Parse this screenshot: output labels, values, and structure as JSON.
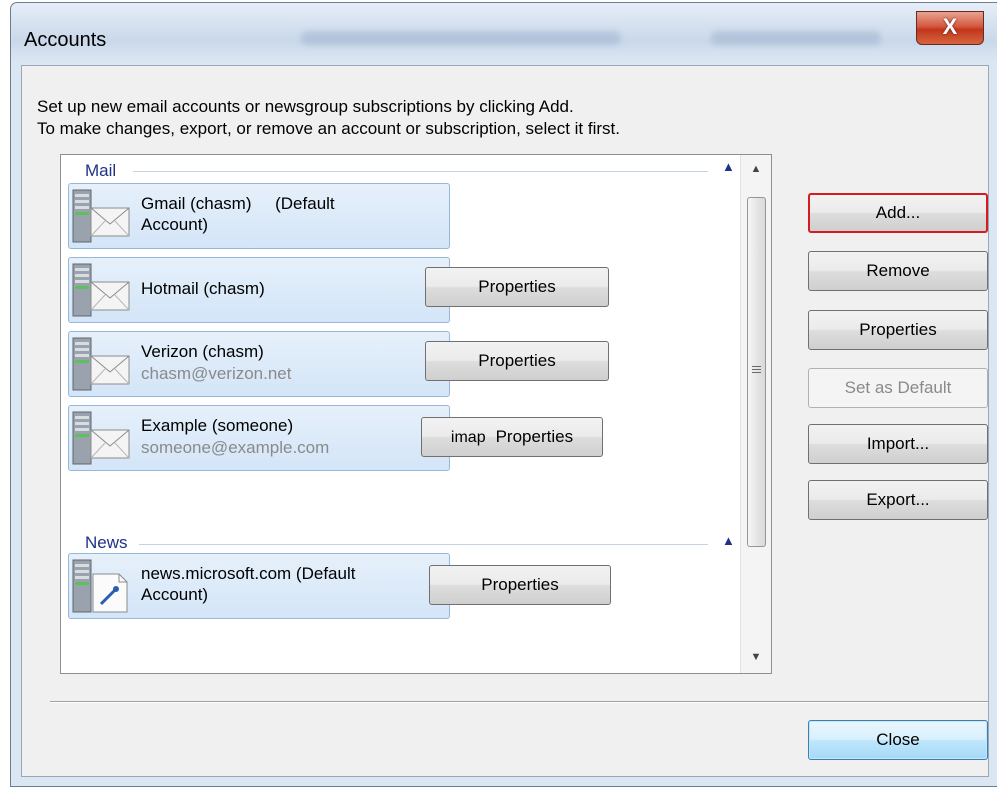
{
  "window": {
    "title": "Accounts",
    "close_glyph": "X"
  },
  "instructions": {
    "line1": "Set up new email accounts or newsgroup subscriptions by clicking Add.",
    "line2": "To make changes, export, or remove an account or subscription, select it first."
  },
  "groups": {
    "mail": {
      "header": "Mail",
      "accounts": [
        {
          "name_line1": "Gmail (chasm)     (Default",
          "name_line2": "Account)"
        },
        {
          "name": "Hotmail (chasm)",
          "button": "Properties"
        },
        {
          "name": "Verizon (chasm)",
          "email": "chasm@verizon.net",
          "button": "Properties"
        },
        {
          "name": "Example (someone)",
          "email": "someone@example.com",
          "tag": "imap",
          "button": "Properties"
        }
      ]
    },
    "news": {
      "header": "News",
      "accounts": [
        {
          "name_line1": "news.microsoft.com (Default",
          "name_line2": "Account)",
          "button": "Properties"
        }
      ]
    }
  },
  "side_buttons": {
    "add": "Add...",
    "remove": "Remove",
    "properties": "Properties",
    "set_default": "Set as Default",
    "import": "Import...",
    "export": "Export..."
  },
  "footer": {
    "close": "Close"
  },
  "icons": {
    "mail_account": "mail-server-icon",
    "news_account": "news-server-icon",
    "collapse": "chevron-up-icon"
  },
  "colors": {
    "group_header": "#1e3287",
    "item_background": "#d3e5f8",
    "focus_border": "#d71920",
    "close_button": "#bee6fd"
  }
}
